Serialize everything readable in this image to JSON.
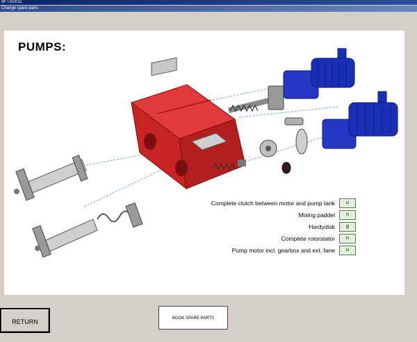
{
  "window": {
    "title": "BFT3r2011",
    "subtitle": "Change spare parts"
  },
  "page": {
    "title": "PUMPS:"
  },
  "parts": [
    {
      "label": "Complete clutch between motor and pump tank",
      "value": "u"
    },
    {
      "label": "Mixing paddel",
      "value": "n"
    },
    {
      "label": "Hardydisk",
      "value": "g"
    },
    {
      "label": "Complete rotorstator",
      "value": "n"
    },
    {
      "label": "Pump motor incl. gearbox and ext. fane",
      "value": "u"
    }
  ],
  "buttons": {
    "return_label": "RETURN",
    "book_label": "BOOK SPARE PARTS"
  },
  "colors": {
    "tank": "#d42a2a",
    "motor": "#1a2fb8",
    "part_button": "#dff1d6",
    "title_bar": "#0a246a"
  }
}
